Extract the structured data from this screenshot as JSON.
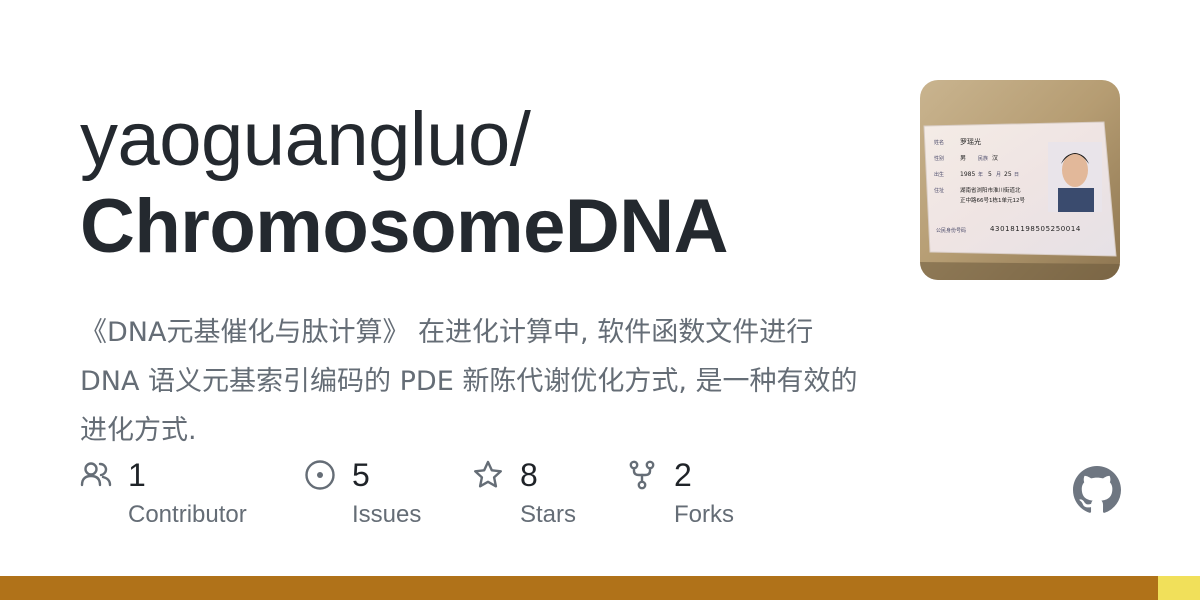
{
  "repo": {
    "owner": "yaoguangluo/",
    "name": "ChromosomeDNA",
    "description": "《DNA元基催化与肽计算》 在进化计算中, 软件函数文件进行 DNA 语义元基索引编码的 PDE 新陈代谢优化方式, 是一种有效的进化方式."
  },
  "avatar": {
    "card_labels": {
      "name_label": "姓名",
      "name": "罗瑶光",
      "sex_label": "性别",
      "sex": "男",
      "ethnic_label": "民族",
      "ethnic": "汉",
      "birth_label": "出生",
      "birth_year": "1985",
      "year_label": "年",
      "birth_month": "5",
      "month_label": "月",
      "birth_day": "25",
      "day_label": "日",
      "address_label": "住址",
      "address_line1": "湖南省浏阳市淮川街道北",
      "address_line2": "正中路66号1栋1单元12号",
      "id_label": "公民身份号码",
      "id_number": "430181198505250014"
    }
  },
  "stats": [
    {
      "count": "1",
      "label": "Contributor",
      "icon": "people-icon"
    },
    {
      "count": "5",
      "label": "Issues",
      "icon": "issue-opened-icon"
    },
    {
      "count": "8",
      "label": "Stars",
      "icon": "star-icon"
    },
    {
      "count": "2",
      "label": "Forks",
      "icon": "repo-forked-icon"
    }
  ],
  "colors": {
    "language_bar_primary": "#b07219",
    "language_bar_secondary": "#f1e05a",
    "icon_gray": "#656d76",
    "github_logo": "#6e7681"
  }
}
